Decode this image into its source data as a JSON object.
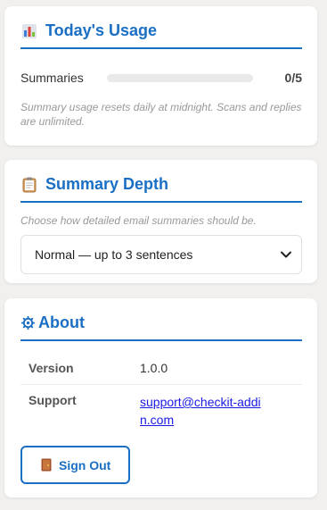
{
  "usage": {
    "title": "Today's Usage",
    "label": "Summaries",
    "count": "0/5",
    "progress_fraction": 0,
    "note": "Summary usage resets daily at midnight. Scans and replies are unlimited."
  },
  "depth": {
    "title": "Summary Depth",
    "hint": "Choose how detailed email summaries should be.",
    "selected": "Normal — up to 3 sentences"
  },
  "about": {
    "title": "About",
    "rows": [
      {
        "key": "Version",
        "value": "1.0.0"
      },
      {
        "key": "Support",
        "value": "support@checkit-addin.com"
      }
    ],
    "signout_label": "Sign Out"
  },
  "colors": {
    "accent": "#1a6fc4",
    "link": "#1a1ae6"
  },
  "icons": {
    "usage": "bar-chart-icon",
    "depth": "clipboard-icon",
    "about": "gear-icon",
    "signout": "door-icon",
    "select": "chevron-down-icon"
  }
}
